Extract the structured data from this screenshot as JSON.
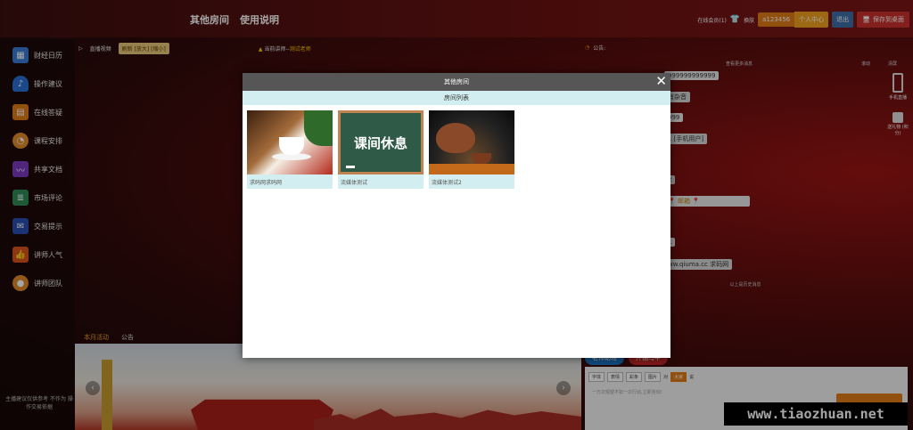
{
  "topbar": {
    "nav": [
      "其他房间",
      "使用说明"
    ],
    "online_label": "在线会员(1)",
    "skin_label": "换肤",
    "username": "a123456",
    "user_center": "个人中心",
    "logout": "退出",
    "save_desktop": "保存到桌面"
  },
  "sidebar": {
    "items": [
      {
        "label": "财经日历",
        "icon": "calendar-icon",
        "color": "#3a7bd5"
      },
      {
        "label": "操作建议",
        "icon": "bell-icon",
        "color": "#2a6fd1"
      },
      {
        "label": "在线答疑",
        "icon": "document-icon",
        "color": "#e07b16"
      },
      {
        "label": "课程安排",
        "icon": "person-clock-icon",
        "color": "#e08a2a"
      },
      {
        "label": "共享文档",
        "icon": "chart-line-icon",
        "color": "#7a3bbf"
      },
      {
        "label": "市场评论",
        "icon": "books-icon",
        "color": "#2e8b57"
      },
      {
        "label": "交易提示",
        "icon": "mail-icon",
        "color": "#2a4fb0"
      },
      {
        "label": "讲师人气",
        "icon": "thumbs-up-icon",
        "color": "#d9541e"
      },
      {
        "label": "讲师团队",
        "icon": "person-icon",
        "color": "#e0892a"
      }
    ],
    "note": "主播建议仅供参考 不作为 操作交易依据"
  },
  "video": {
    "live_label": "直播视频",
    "refresh_label": "刷新 [放大] [缩小]",
    "teacher_prefix": "当前讲师--",
    "teacher_name": "测试老师"
  },
  "bottom": {
    "tabs": [
      "本月活动",
      "公告"
    ]
  },
  "chat": {
    "notice_label": "公告:",
    "more_label": "查看更多消息",
    "scroll_label": "滚动",
    "clear_label": "清屏",
    "messages": [
      "999999999999",
      "有杂音",
      "999",
      "1 [手机用户]",
      "2",
      "📍 邮箱 📍",
      "1",
      "ww.qiuma.cc 求码网"
    ],
    "history_label": "以上是历史消息",
    "phone_label": "手机直播",
    "gift_label": "送礼物 (积分)",
    "tabs": [
      "老师助理",
      "开抽马甲"
    ],
    "toolbar": [
      "字体",
      "表情",
      "彩条",
      "图片",
      "对",
      "大家",
      "说"
    ],
    "input_placeholder": "一万次观望不如一次行动,立即咨询！"
  },
  "modal": {
    "title": "其他房间",
    "close": "✕",
    "subtitle": "房间列表",
    "rooms": [
      {
        "name": "求码网求码网",
        "board_text": ""
      },
      {
        "name": "流媒体测试",
        "board_text": "课间休息"
      },
      {
        "name": "流媒体测试2",
        "board_text": ""
      }
    ]
  },
  "watermark": "www.tiaozhuan.net"
}
